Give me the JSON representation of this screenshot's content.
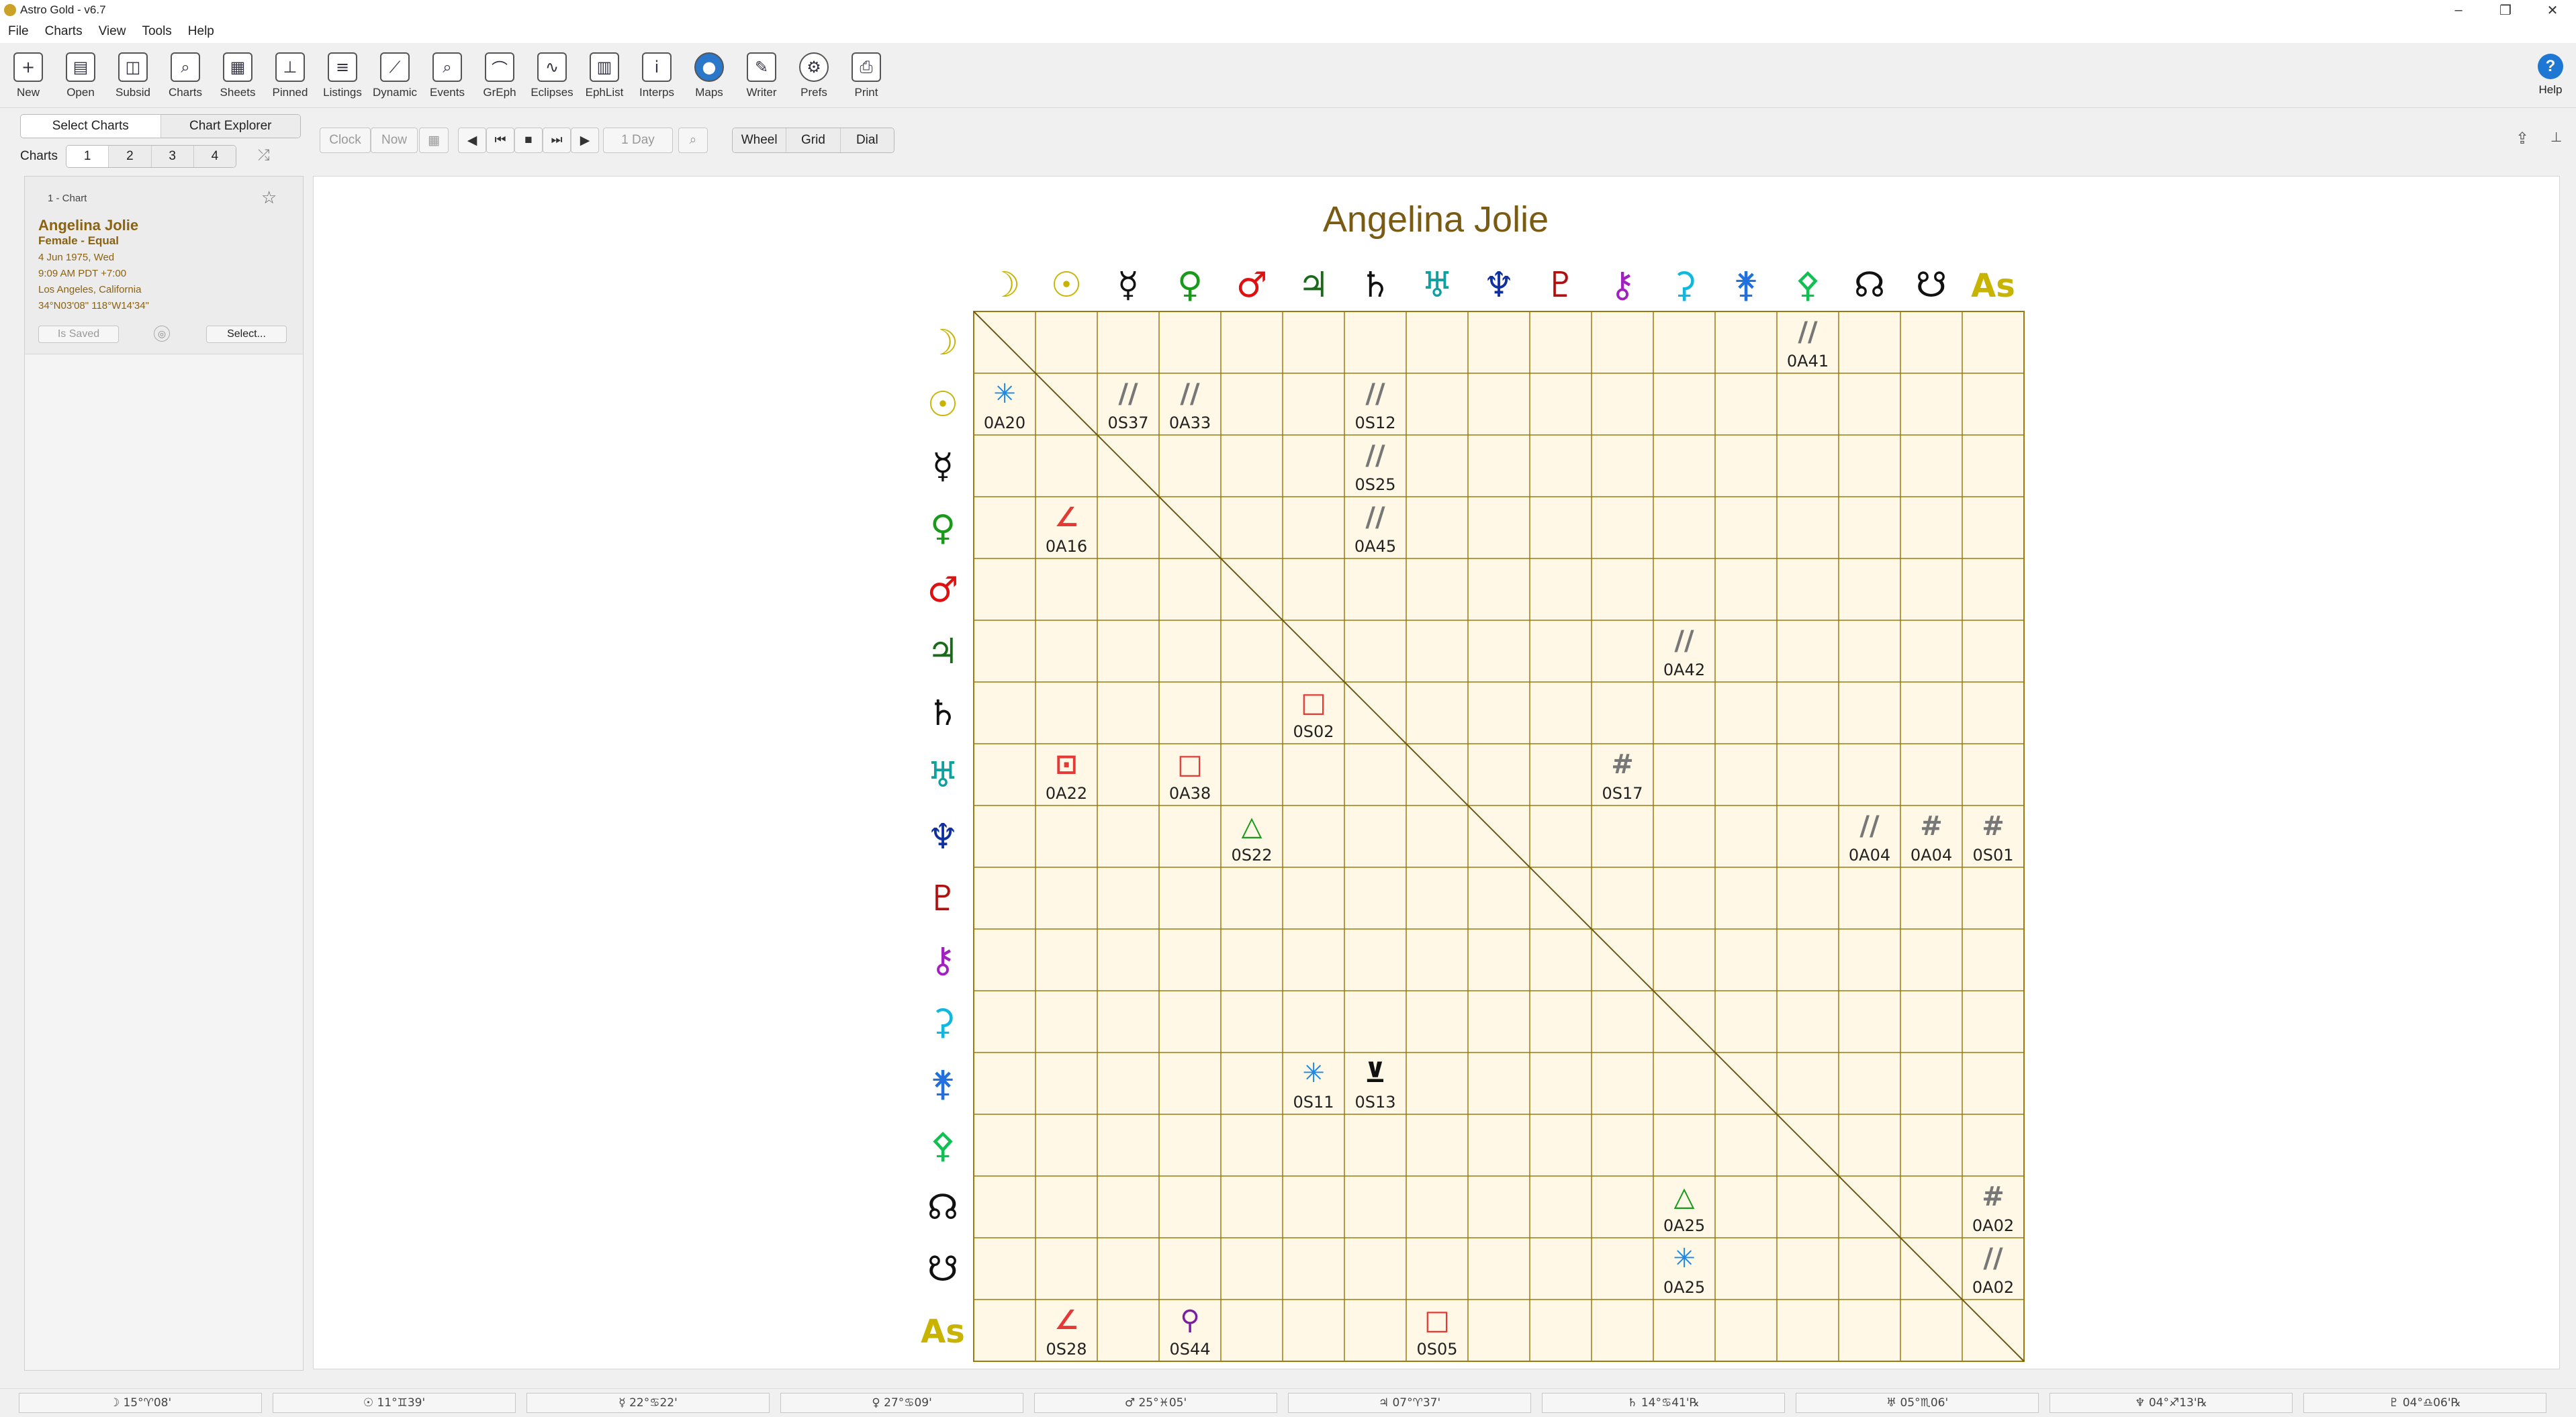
{
  "window": {
    "title": "Astro Gold - v6.7"
  },
  "menu": [
    "File",
    "Charts",
    "View",
    "Tools",
    "Help"
  ],
  "toolbar": [
    {
      "label": "New",
      "glyph": "+"
    },
    {
      "label": "Open",
      "glyph": "▤"
    },
    {
      "label": "Subsid",
      "glyph": "◫"
    },
    {
      "label": "Charts",
      "glyph": "⌕"
    },
    {
      "label": "Sheets",
      "glyph": "▦"
    },
    {
      "label": "Pinned",
      "glyph": "⊥"
    },
    {
      "label": "Listings",
      "glyph": "≡"
    },
    {
      "label": "Dynamic",
      "glyph": "⟋"
    },
    {
      "label": "Events",
      "glyph": "⌕"
    },
    {
      "label": "GrEph",
      "glyph": "⌒"
    },
    {
      "label": "Eclipses",
      "glyph": "∿"
    },
    {
      "label": "EphList",
      "glyph": "▥"
    },
    {
      "label": "Interps",
      "glyph": "i"
    },
    {
      "label": "Maps",
      "glyph": "●"
    },
    {
      "label": "Writer",
      "glyph": "✎"
    },
    {
      "label": "Prefs",
      "glyph": "⚙"
    },
    {
      "label": "Print",
      "glyph": "⎙"
    }
  ],
  "help_label": "Help",
  "sidebar": {
    "tabs": [
      "Select Charts",
      "Chart Explorer"
    ],
    "charts_label": "Charts",
    "chart_tabs": [
      "1",
      "2",
      "3",
      "4"
    ],
    "card": {
      "header": "1 - Chart",
      "name": "Angelina Jolie",
      "type": "Female - Equal",
      "date": "4 Jun 1975, Wed",
      "time": "9:09 AM PDT +7:00",
      "place": "Los Angeles, California",
      "coords": "34°N03'08\" 118°W14'34\"",
      "saved_label": "Is Saved",
      "select_label": "Select..."
    }
  },
  "nav": {
    "clock": "Clock",
    "now": "Now",
    "step": "1 Day",
    "views": [
      "Wheel",
      "Grid",
      "Dial"
    ]
  },
  "grid": {
    "title": "Angelina Jolie",
    "planets": [
      {
        "g": "☽",
        "c": "#c8b400"
      },
      {
        "g": "☉",
        "c": "#c8b400"
      },
      {
        "g": "☿",
        "c": "#111111"
      },
      {
        "g": "♀",
        "c": "#1a9a1a"
      },
      {
        "g": "♂",
        "c": "#e01010"
      },
      {
        "g": "♃",
        "c": "#1a6a1a"
      },
      {
        "g": "♄",
        "c": "#111111"
      },
      {
        "g": "♅",
        "c": "#10a0a0"
      },
      {
        "g": "♆",
        "c": "#1030a0"
      },
      {
        "g": "♇",
        "c": "#b01010"
      },
      {
        "g": "⚷",
        "c": "#a020c0"
      },
      {
        "g": "⚳",
        "c": "#10b8e0"
      },
      {
        "g": "⚵",
        "c": "#2070e0"
      },
      {
        "g": "⚴",
        "c": "#10c050"
      },
      {
        "g": "☊",
        "c": "#111111"
      },
      {
        "g": "☋",
        "c": "#111111"
      },
      {
        "g": "As",
        "c": "#c8b400"
      }
    ],
    "aspects": [
      {
        "r": 0,
        "c": 13,
        "s": "//",
        "t": "0A41",
        "k": "#777777"
      },
      {
        "r": 1,
        "c": 0,
        "s": "✳",
        "t": "0A20",
        "k": "#1e88e5"
      },
      {
        "r": 1,
        "c": 2,
        "s": "//",
        "t": "0S37",
        "k": "#777777"
      },
      {
        "r": 1,
        "c": 3,
        "s": "//",
        "t": "0A33",
        "k": "#777777"
      },
      {
        "r": 1,
        "c": 6,
        "s": "//",
        "t": "0S12",
        "k": "#777777"
      },
      {
        "r": 2,
        "c": 6,
        "s": "//",
        "t": "0S25",
        "k": "#777777"
      },
      {
        "r": 3,
        "c": 1,
        "s": "∠",
        "t": "0A16",
        "k": "#e53935"
      },
      {
        "r": 3,
        "c": 6,
        "s": "//",
        "t": "0A45",
        "k": "#777777"
      },
      {
        "r": 5,
        "c": 11,
        "s": "//",
        "t": "0A42",
        "k": "#777777"
      },
      {
        "r": 6,
        "c": 5,
        "s": "□",
        "t": "0S02",
        "k": "#e53935"
      },
      {
        "r": 7,
        "c": 1,
        "s": "⊡",
        "t": "0A22",
        "k": "#e53935"
      },
      {
        "r": 7,
        "c": 3,
        "s": "□",
        "t": "0A38",
        "k": "#e53935"
      },
      {
        "r": 7,
        "c": 10,
        "s": "#",
        "t": "0S17",
        "k": "#777777"
      },
      {
        "r": 8,
        "c": 4,
        "s": "△",
        "t": "0S22",
        "k": "#1a9a1a"
      },
      {
        "r": 8,
        "c": 14,
        "s": "//",
        "t": "0A04",
        "k": "#777777"
      },
      {
        "r": 8,
        "c": 15,
        "s": "#",
        "t": "0A04",
        "k": "#777777"
      },
      {
        "r": 8,
        "c": 16,
        "s": "#",
        "t": "0S01",
        "k": "#777777"
      },
      {
        "r": 12,
        "c": 5,
        "s": "✳",
        "t": "0S11",
        "k": "#1e88e5"
      },
      {
        "r": 12,
        "c": 6,
        "s": "⊻",
        "t": "0S13",
        "k": "#111111"
      },
      {
        "r": 14,
        "c": 11,
        "s": "△",
        "t": "0A25",
        "k": "#1a9a1a"
      },
      {
        "r": 14,
        "c": 16,
        "s": "#",
        "t": "0A02",
        "k": "#777777"
      },
      {
        "r": 15,
        "c": 11,
        "s": "✳",
        "t": "0A25",
        "k": "#1e88e5"
      },
      {
        "r": 15,
        "c": 16,
        "s": "//",
        "t": "0A02",
        "k": "#777777"
      },
      {
        "r": 16,
        "c": 1,
        "s": "∠",
        "t": "0S28",
        "k": "#e53935"
      },
      {
        "r": 16,
        "c": 3,
        "s": "⚲",
        "t": "0S44",
        "k": "#7b1fa2"
      },
      {
        "r": 16,
        "c": 7,
        "s": "□",
        "t": "0S05",
        "k": "#e53935"
      }
    ]
  },
  "status": [
    "☽ 15°♈08'",
    "☉ 11°♊39'",
    "☿ 22°♋22'",
    "♀ 27°♋09'",
    "♂ 25°♓05'",
    "♃ 07°♈37'",
    "♄ 14°♋41'℞",
    "♅ 05°♏06'",
    "♆ 04°♐13'℞",
    "♇ 04°♎06'℞"
  ]
}
